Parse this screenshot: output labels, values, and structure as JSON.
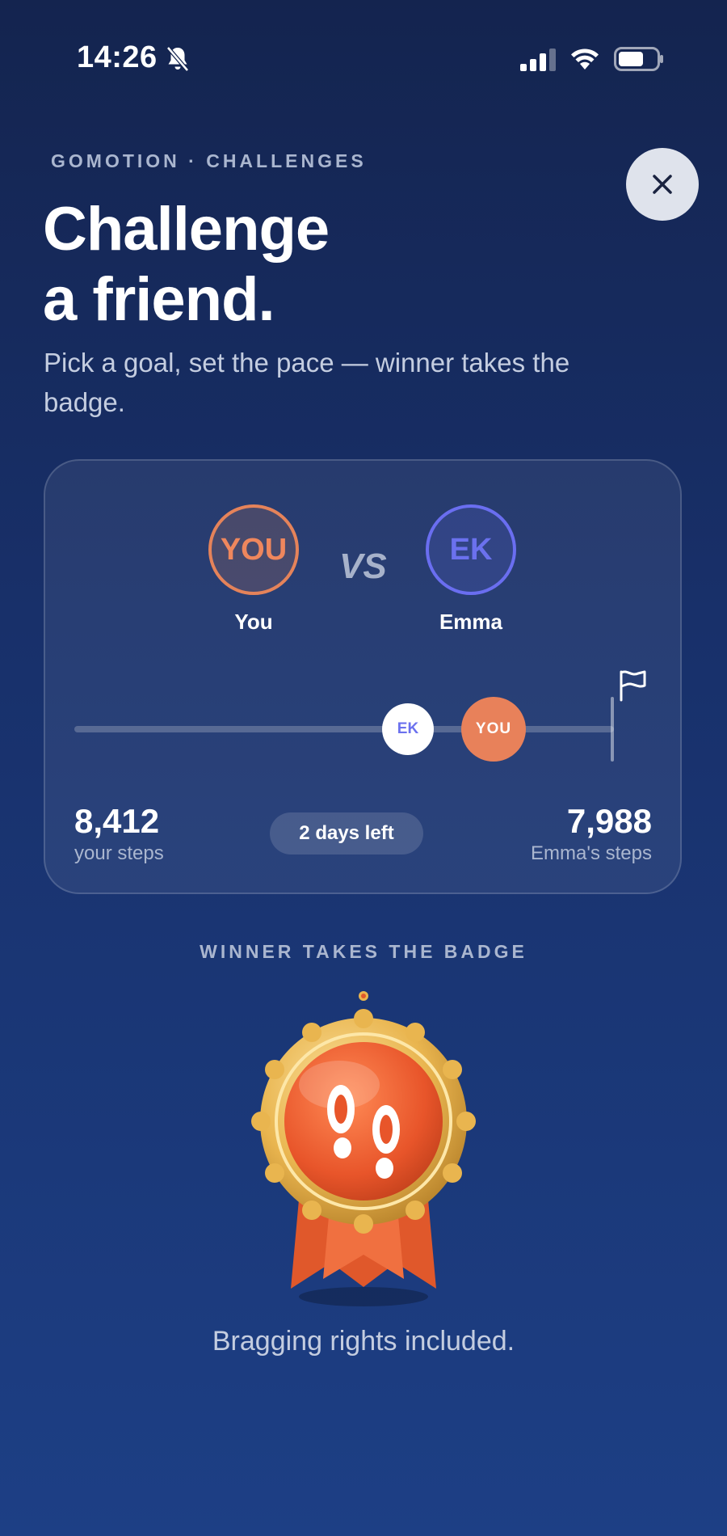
{
  "status_bar": {
    "time": "14:26",
    "icons": [
      "bell-slash-icon",
      "cellular-signal-icon",
      "wifi-icon",
      "battery-icon"
    ]
  },
  "header": {
    "eyebrow": "GOMOTION · CHALLENGES",
    "title_line1": "Challenge",
    "title_line2": "a friend.",
    "subtitle": "Pick a goal, set the pace — winner takes the badge.",
    "close_icon": "close-icon"
  },
  "challenge": {
    "you": {
      "avatar_text": "YOU",
      "name": "You",
      "marker_text": "YOU",
      "steps": "8,412",
      "steps_label": "your steps",
      "color": "#e8815a",
      "progress": 0.74
    },
    "vs_label": "VS",
    "opponent": {
      "avatar_text": "EK",
      "name": "Emma",
      "marker_text": "EK",
      "steps": "7,988",
      "steps_label": "Emma's steps",
      "color": "#6b71ee",
      "progress": 0.6
    },
    "days_left": "2 days left",
    "finish_icon": "flag-icon"
  },
  "badge": {
    "heading": "WINNER TAKES THE BADGE",
    "icon": "footprints-medal-icon",
    "tagline": "Bragging rights included."
  }
}
